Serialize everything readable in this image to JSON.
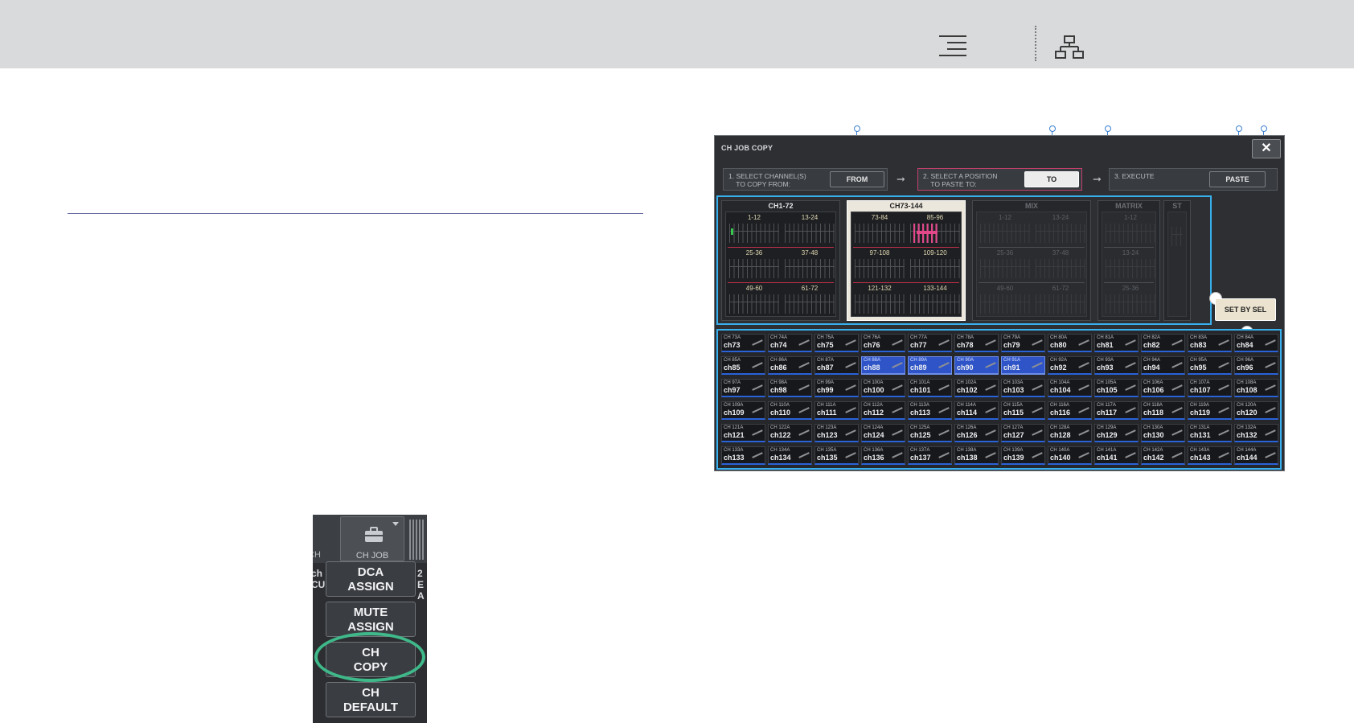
{
  "topbar": {
    "icons": [
      "list-icon",
      "tree-icon"
    ]
  },
  "dialog": {
    "title": "CH JOB COPY",
    "close_label": "✕",
    "steps": [
      {
        "text": "1. SELECT CHANNEL(S)\n    TO COPY FROM:",
        "button": "FROM"
      },
      {
        "text": "2. SELECT A POSITION\n    TO PASTE TO:",
        "button": "TO"
      },
      {
        "text": "3. EXECUTE",
        "button": "PASTE"
      }
    ],
    "arrow": "➞",
    "banks": [
      {
        "title": "CH1-72",
        "groups": [
          "1-12",
          "13-24",
          "25-36",
          "37-48",
          "49-60",
          "61-72"
        ]
      },
      {
        "title": "CH73-144",
        "groups": [
          "73-84",
          "85-96",
          "97-108",
          "109-120",
          "121-132",
          "133-144"
        ]
      },
      {
        "title": "MIX",
        "groups": [
          "1-12",
          "13-24",
          "25-36",
          "37-48",
          "49-60",
          "61-72"
        ]
      },
      {
        "title": "MATRIX",
        "groups": [
          "1-12",
          "13-24",
          "25-36"
        ]
      },
      {
        "title": "ST",
        "groups": []
      }
    ],
    "set_by_sel": "SET BY SEL",
    "channels": [
      [
        "CH 73A",
        "ch73"
      ],
      [
        "CH 74A",
        "ch74"
      ],
      [
        "CH 75A",
        "ch75"
      ],
      [
        "CH 76A",
        "ch76"
      ],
      [
        "CH 77A",
        "ch77"
      ],
      [
        "CH 78A",
        "ch78"
      ],
      [
        "CH 79A",
        "ch79"
      ],
      [
        "CH 80A",
        "ch80"
      ],
      [
        "CH 81A",
        "ch81"
      ],
      [
        "CH 82A",
        "ch82"
      ],
      [
        "CH 83A",
        "ch83"
      ],
      [
        "CH 84A",
        "ch84"
      ],
      [
        "CH 85A",
        "ch85"
      ],
      [
        "CH 86A",
        "ch86"
      ],
      [
        "CH 87A",
        "ch87"
      ],
      [
        "CH 88A",
        "ch88"
      ],
      [
        "CH 89A",
        "ch89"
      ],
      [
        "CH 90A",
        "ch90"
      ],
      [
        "CH 91A",
        "ch91"
      ],
      [
        "CH 92A",
        "ch92"
      ],
      [
        "CH 93A",
        "ch93"
      ],
      [
        "CH 94A",
        "ch94"
      ],
      [
        "CH 95A",
        "ch95"
      ],
      [
        "CH 96A",
        "ch96"
      ],
      [
        "CH 97A",
        "ch97"
      ],
      [
        "CH 98A",
        "ch98"
      ],
      [
        "CH 99A",
        "ch99"
      ],
      [
        "CH 100A",
        "ch100"
      ],
      [
        "CH 101A",
        "ch101"
      ],
      [
        "CH 102A",
        "ch102"
      ],
      [
        "CH 103A",
        "ch103"
      ],
      [
        "CH 104A",
        "ch104"
      ],
      [
        "CH 105A",
        "ch105"
      ],
      [
        "CH 106A",
        "ch106"
      ],
      [
        "CH 107A",
        "ch107"
      ],
      [
        "CH 108A",
        "ch108"
      ],
      [
        "CH 109A",
        "ch109"
      ],
      [
        "CH 110A",
        "ch110"
      ],
      [
        "CH 111A",
        "ch111"
      ],
      [
        "CH 112A",
        "ch112"
      ],
      [
        "CH 113A",
        "ch113"
      ],
      [
        "CH 114A",
        "ch114"
      ],
      [
        "CH 115A",
        "ch115"
      ],
      [
        "CH 116A",
        "ch116"
      ],
      [
        "CH 117A",
        "ch117"
      ],
      [
        "CH 118A",
        "ch118"
      ],
      [
        "CH 119A",
        "ch119"
      ],
      [
        "CH 120A",
        "ch120"
      ],
      [
        "CH 121A",
        "ch121"
      ],
      [
        "CH 122A",
        "ch122"
      ],
      [
        "CH 123A",
        "ch123"
      ],
      [
        "CH 124A",
        "ch124"
      ],
      [
        "CH 125A",
        "ch125"
      ],
      [
        "CH 126A",
        "ch126"
      ],
      [
        "CH 127A",
        "ch127"
      ],
      [
        "CH 128A",
        "ch128"
      ],
      [
        "CH 129A",
        "ch129"
      ],
      [
        "CH 130A",
        "ch130"
      ],
      [
        "CH 131A",
        "ch131"
      ],
      [
        "CH 132A",
        "ch132"
      ],
      [
        "CH 133A",
        "ch133"
      ],
      [
        "CH 134A",
        "ch134"
      ],
      [
        "CH 135A",
        "ch135"
      ],
      [
        "CH 136A",
        "ch136"
      ],
      [
        "CH 137A",
        "ch137"
      ],
      [
        "CH 138A",
        "ch138"
      ],
      [
        "CH 139A",
        "ch139"
      ],
      [
        "CH 140A",
        "ch140"
      ],
      [
        "CH 141A",
        "ch141"
      ],
      [
        "CH 142A",
        "ch142"
      ],
      [
        "CH 143A",
        "ch143"
      ],
      [
        "CH 144A",
        "ch144"
      ]
    ],
    "selected_channels": [
      "ch88",
      "ch89",
      "ch90",
      "ch91"
    ]
  },
  "popup": {
    "tab_label": "CH JOB",
    "left_partial": "CH",
    "side_left": [
      "ch",
      "CU"
    ],
    "side_right": [
      "2",
      "E A"
    ],
    "items": [
      {
        "line1": "DCA",
        "line2": "ASSIGN"
      },
      {
        "line1": "MUTE",
        "line2": "ASSIGN"
      },
      {
        "line1": "CH",
        "line2": "COPY"
      },
      {
        "line1": "CH",
        "line2": "DEFAULT"
      }
    ]
  },
  "colors": {
    "accent": "#39b0ee",
    "selected": "#2f54c8",
    "highlight_ring": "#3fb98a",
    "pink": "#e2478a"
  }
}
